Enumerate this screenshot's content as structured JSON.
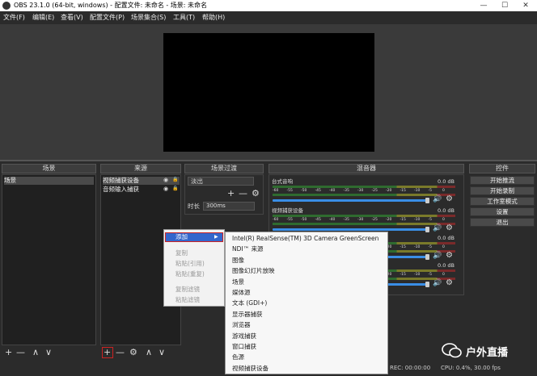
{
  "window": {
    "title": "OBS 23.1.0 (64-bit, windows) - 配置文件: 未命名 - 场景: 未命名",
    "minimize_glyph": "—",
    "maximize_glyph": "☐",
    "close_glyph": "✕"
  },
  "menu": [
    "文件(F)",
    "编辑(E)",
    "查看(V)",
    "配置文件(P)",
    "场景集合(S)",
    "工具(T)",
    "帮助(H)"
  ],
  "docks": {
    "scenes": {
      "title": "场景",
      "items": [
        "场景"
      ]
    },
    "sources": {
      "title": "来源",
      "items": [
        "视频捕获设备",
        "音频输入捕获"
      ]
    },
    "transitions": {
      "title": "场景过渡",
      "selected": "淡出",
      "duration_label": "时长",
      "duration_value": "300ms"
    },
    "mixer": {
      "title": "混音器",
      "channels": [
        {
          "name": "台式音响",
          "db": "0.0 dB"
        },
        {
          "name": "视频捕获设备",
          "db": "0.0 dB"
        },
        {
          "name": "",
          "db": "0.0 dB"
        },
        {
          "name": "",
          "db": "0.0 dB"
        }
      ],
      "ticks": [
        "-60",
        "-55",
        "-50",
        "-45",
        "-40",
        "-35",
        "-30",
        "-25",
        "-20",
        "-15",
        "-10",
        "-5",
        "0"
      ]
    },
    "controls": {
      "title": "控件",
      "buttons": [
        "开始推流",
        "开始录制",
        "工作室模式",
        "设置",
        "退出"
      ]
    }
  },
  "glyphs": {
    "plus": "+",
    "minus": "—",
    "up": "∧",
    "down": "∨",
    "gear": "⚙",
    "eye": "◉",
    "lock": "🔒",
    "speaker": "🔊",
    "arrow": "▶"
  },
  "context_menu": {
    "items": [
      "添加",
      "复制",
      "粘贴(引用)",
      "粘贴(重复)",
      "复制滤镜",
      "粘贴滤镜"
    ],
    "submenu": [
      "Intel(R) RealSense(TM) 3D Camera GreenScreen",
      "NDI™ 来源",
      "图像",
      "图像幻灯片放映",
      "场景",
      "媒体源",
      "文本 (GDI+)",
      "显示器捕获",
      "浏览器",
      "游戏捕获",
      "窗口捕获",
      "色源",
      "视频捕获设备"
    ]
  },
  "status": {
    "rec": "REC: 00:00:00",
    "cpu": "CPU: 0.4%, 30.00 fps"
  },
  "watermark": {
    "text": "户外直播"
  },
  "colors": {
    "accent": "#3a8ee6",
    "highlight_border": "#cc2222",
    "selection": "#3366cc"
  }
}
